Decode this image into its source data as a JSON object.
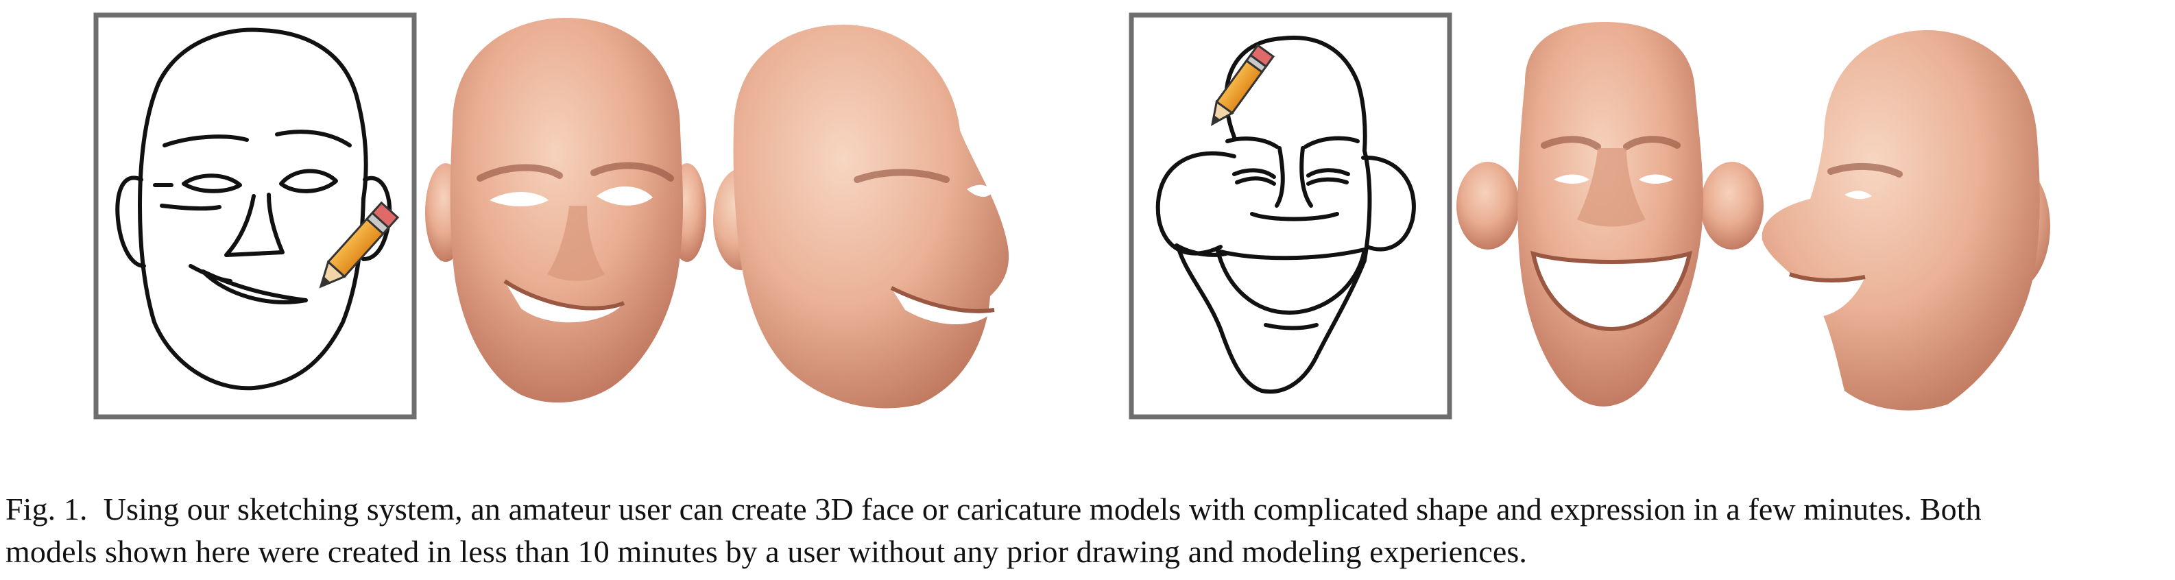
{
  "figure": {
    "panels": [
      {
        "id": "sketch-face",
        "kind": "sketch"
      },
      {
        "id": "face-model-front",
        "kind": "3d-render"
      },
      {
        "id": "face-model-side",
        "kind": "3d-render"
      },
      {
        "id": "sketch-caricature",
        "kind": "sketch"
      },
      {
        "id": "caricature-model-front",
        "kind": "3d-render"
      },
      {
        "id": "caricature-model-side",
        "kind": "3d-render"
      }
    ],
    "colors": {
      "skin_light": "#f3c8ae",
      "skin_mid": "#e4a488",
      "skin_dark": "#b8715a",
      "frame_border": "#6e6e6e",
      "pencil_body": "#f2a531",
      "pencil_eraser": "#d95a5a",
      "stroke": "#111111"
    },
    "icons": [
      "pencil-icon"
    ]
  },
  "caption": {
    "line1": "Fig. 1.  Using our sketching system, an amateur user can create 3D face or caricature models with complicated shape and expression in a few minutes. Both",
    "line2": "models shown here were created in less than 10 minutes by a user without any prior drawing and modeling experiences."
  }
}
